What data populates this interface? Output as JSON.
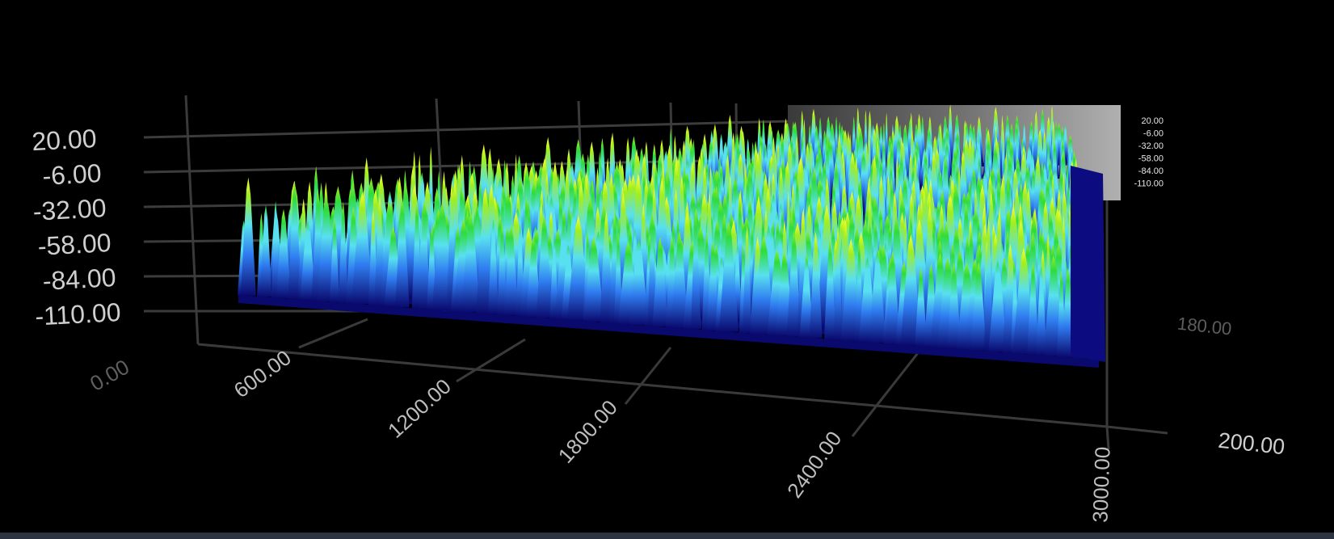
{
  "chart_data": {
    "type": "surface3d",
    "title": "",
    "xlabel": "",
    "ylabel": "",
    "zlabel": "",
    "x_ticks": [
      "0.00",
      "600.00",
      "1200.00",
      "1800.00",
      "2400.00",
      "3000.00"
    ],
    "x_range": [
      0,
      3000
    ],
    "y_ticks": [
      "180.00",
      "200.00"
    ],
    "y_range": [
      0,
      200
    ],
    "z_ticks": [
      "20.00",
      "-6.00",
      "-32.00",
      "-58.00",
      "-84.00",
      "-110.00"
    ],
    "z_range": [
      -110,
      20
    ],
    "colorbar_ticks": [
      "20.00",
      "-6.00",
      "-32.00",
      "-58.00",
      "-84.00",
      "-110.00"
    ],
    "colormap": [
      "#0a0a6e",
      "#1a2ad0",
      "#2f7cf0",
      "#58e0f0",
      "#2fdc3a",
      "#a0ee20",
      "#ffff30"
    ],
    "grid": true,
    "surface": {
      "noise_floor_z": -110,
      "typical_peak_z": [
        -30,
        10
      ]
    }
  }
}
